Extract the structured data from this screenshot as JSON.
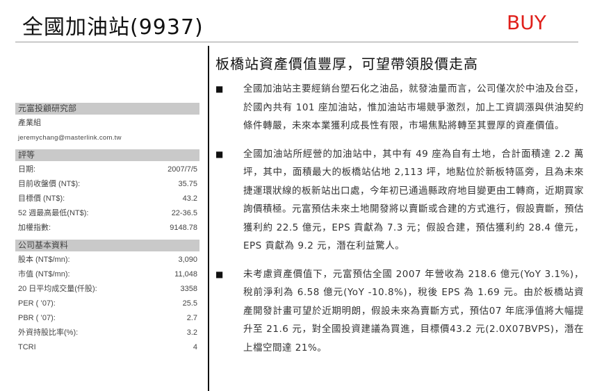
{
  "header": {
    "title": "全國加油站(9937)",
    "rating": "BUY"
  },
  "sidebar": {
    "research": {
      "heading": "元富投顧研究部",
      "group": "產業組",
      "email": "jeremychang@masterlink.com.tw"
    },
    "rating_section": {
      "heading": "評等",
      "rows": [
        {
          "label": "日期:",
          "value": "2007/7/5"
        },
        {
          "label": "目前收盤價 (NT$):",
          "value": "35.75"
        },
        {
          "label": "目標價 (NT$):",
          "value": "43.2"
        },
        {
          "label": "52 週最高最低(NT$):",
          "value": "22-36.5"
        },
        {
          "label": "加權指數:",
          "value": "9148.78"
        }
      ]
    },
    "company_section": {
      "heading": "公司基本資料",
      "rows": [
        {
          "label": "股本 (NT$/mn):",
          "value": "3,090"
        },
        {
          "label": "市值 (NT$/mn):",
          "value": "11,048"
        },
        {
          "label": "20 日平均成交量(仟股):",
          "value": "3358"
        },
        {
          "label": "PER ( ’07):",
          "value": "25.5"
        },
        {
          "label": "PBR ( ’07):",
          "value": "2.7"
        },
        {
          "label": "外資持股比率(%):",
          "value": "3.2"
        },
        {
          "label": "TCRI",
          "value": "4"
        }
      ]
    }
  },
  "main": {
    "headline": "板橋站資產價值豐厚，可望帶領股價走高",
    "bullet_symbol": "■",
    "bullets": [
      "全國加油站主要經銷台塑石化之油品，就發油量而言，公司僅次於中油及台亞，於國內共有 101 座加油站，惟加油站市場競爭激烈，加上工資調漲與供油契約條件轉嚴，未來本業獲利成長性有限，市場焦點將轉至其豐厚的資產價值。",
      "全國加油站所經營的加油站中，其中有 49 座為自有土地，合計面積達 2.2 萬坪，其中，面積最大的板橋站佔地 2,113 坪，地點位於新板特區旁，且為未來捷運環狀線的板新站出口處，今年初已通過縣政府地目變更由工轉商，近期買家詢價積極。元富預估未來土地開發將以賣斷或合建的方式進行，假設賣斷，預估獲利約 22.5 億元，EPS 貢獻為 7.3 元；假設合建，預估獲利約 28.4 億元，EPS 貢獻為 9.2 元，潛在利益驚人。",
      "未考慮資產價值下，元富預估全國 2007 年營收為 218.6 億元(YoY 3.1%)，稅前淨利為 6.58 億元(YoY -10.8%)，稅後 EPS 為 1.69 元。由於板橋站資產開發計畫可望於近期明朗，假設未來為賣斷方式，預估07 年底淨值將大幅提升至 21.6 元，對全國投資建議為買進，目標價43.2 元(2.0X07BVPS)，潛在上檔空間達 21%。"
    ]
  }
}
